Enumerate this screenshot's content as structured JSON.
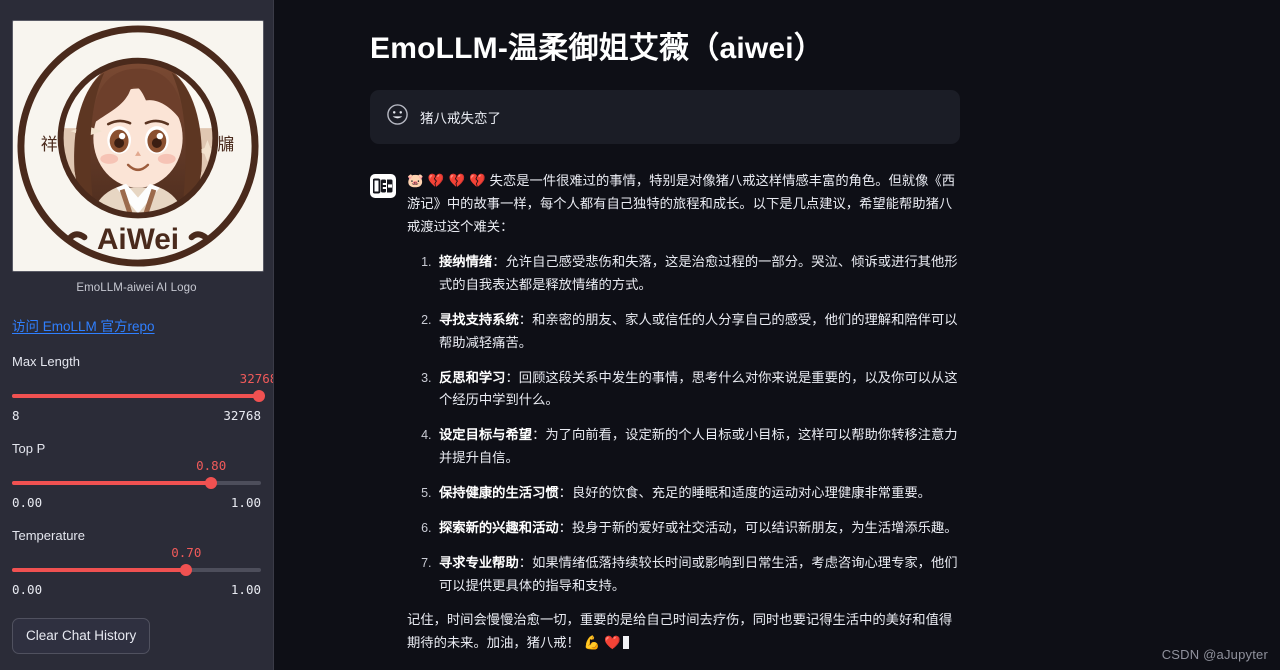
{
  "sidebar": {
    "logo": {
      "caption": "EmoLLM-aiwei AI Logo",
      "name_text": "AiWei",
      "left_char": "祥",
      "right_char": "牖"
    },
    "repo_link": "访问 EmoLLM 官方repo",
    "sliders": [
      {
        "name": "max-length",
        "label": "Max Length",
        "value": "32768",
        "min": "8",
        "max": "32768",
        "fill_pct": 99
      },
      {
        "name": "top-p",
        "label": "Top P",
        "value": "0.80",
        "min": "0.00",
        "max": "1.00",
        "fill_pct": 80
      },
      {
        "name": "temperature",
        "label": "Temperature",
        "value": "0.70",
        "min": "0.00",
        "max": "1.00",
        "fill_pct": 70
      }
    ],
    "clear_button": "Clear Chat History"
  },
  "main": {
    "title": "EmoLLM-温柔御姐艾薇（aiwei）",
    "user_message": {
      "avatar_icon": "smiley-face-icon",
      "text": "猪八戒失恋了"
    },
    "bot_message": {
      "avatar_icon": "robot-face-icon",
      "emojis": "🐷 💔 💔 💔",
      "intro": "失恋是一件很难过的事情，特别是对像猪八戒这样情感丰富的角色。但就像《西游记》中的故事一样，每个人都有自己独特的旅程和成长。以下是几点建议，希望能帮助猪八戒渡过这个难关：",
      "items": [
        {
          "heading": "接纳情绪",
          "body": "：允许自己感受悲伤和失落，这是治愈过程的一部分。哭泣、倾诉或进行其他形式的自我表达都是释放情绪的方式。"
        },
        {
          "heading": "寻找支持系统",
          "body": "：和亲密的朋友、家人或信任的人分享自己的感受，他们的理解和陪伴可以帮助减轻痛苦。"
        },
        {
          "heading": "反思和学习",
          "body": "：回顾这段关系中发生的事情，思考什么对你来说是重要的，以及你可以从这个经历中学到什么。"
        },
        {
          "heading": "设定目标与希望",
          "body": "：为了向前看，设定新的个人目标或小目标，这样可以帮助你转移注意力并提升自信。"
        },
        {
          "heading": "保持健康的生活习惯",
          "body": "：良好的饮食、充足的睡眠和适度的运动对心理健康非常重要。"
        },
        {
          "heading": "探索新的兴趣和活动",
          "body": "：投身于新的爱好或社交活动，可以结识新朋友，为生活增添乐趣。"
        },
        {
          "heading": "寻求专业帮助",
          "body": "：如果情绪低落持续较长时间或影响到日常生活，考虑咨询心理专家，他们可以提供更具体的指导和支持。"
        }
      ],
      "closing": "记住，时间会慢慢治愈一切，重要的是给自己时间去疗伤，同时也要记得生活中的美好和值得期待的未来。加油，猪八戒！",
      "closing_emojis": "💪 ❤️"
    }
  },
  "watermark": "CSDN @aJupyter",
  "colors": {
    "accent_red": "#f05151",
    "link_blue": "#2f7fff",
    "sidebar_bg": "#2b2c38",
    "main_bg": "#0e0f16",
    "bubble_bg": "#1b1d26"
  }
}
